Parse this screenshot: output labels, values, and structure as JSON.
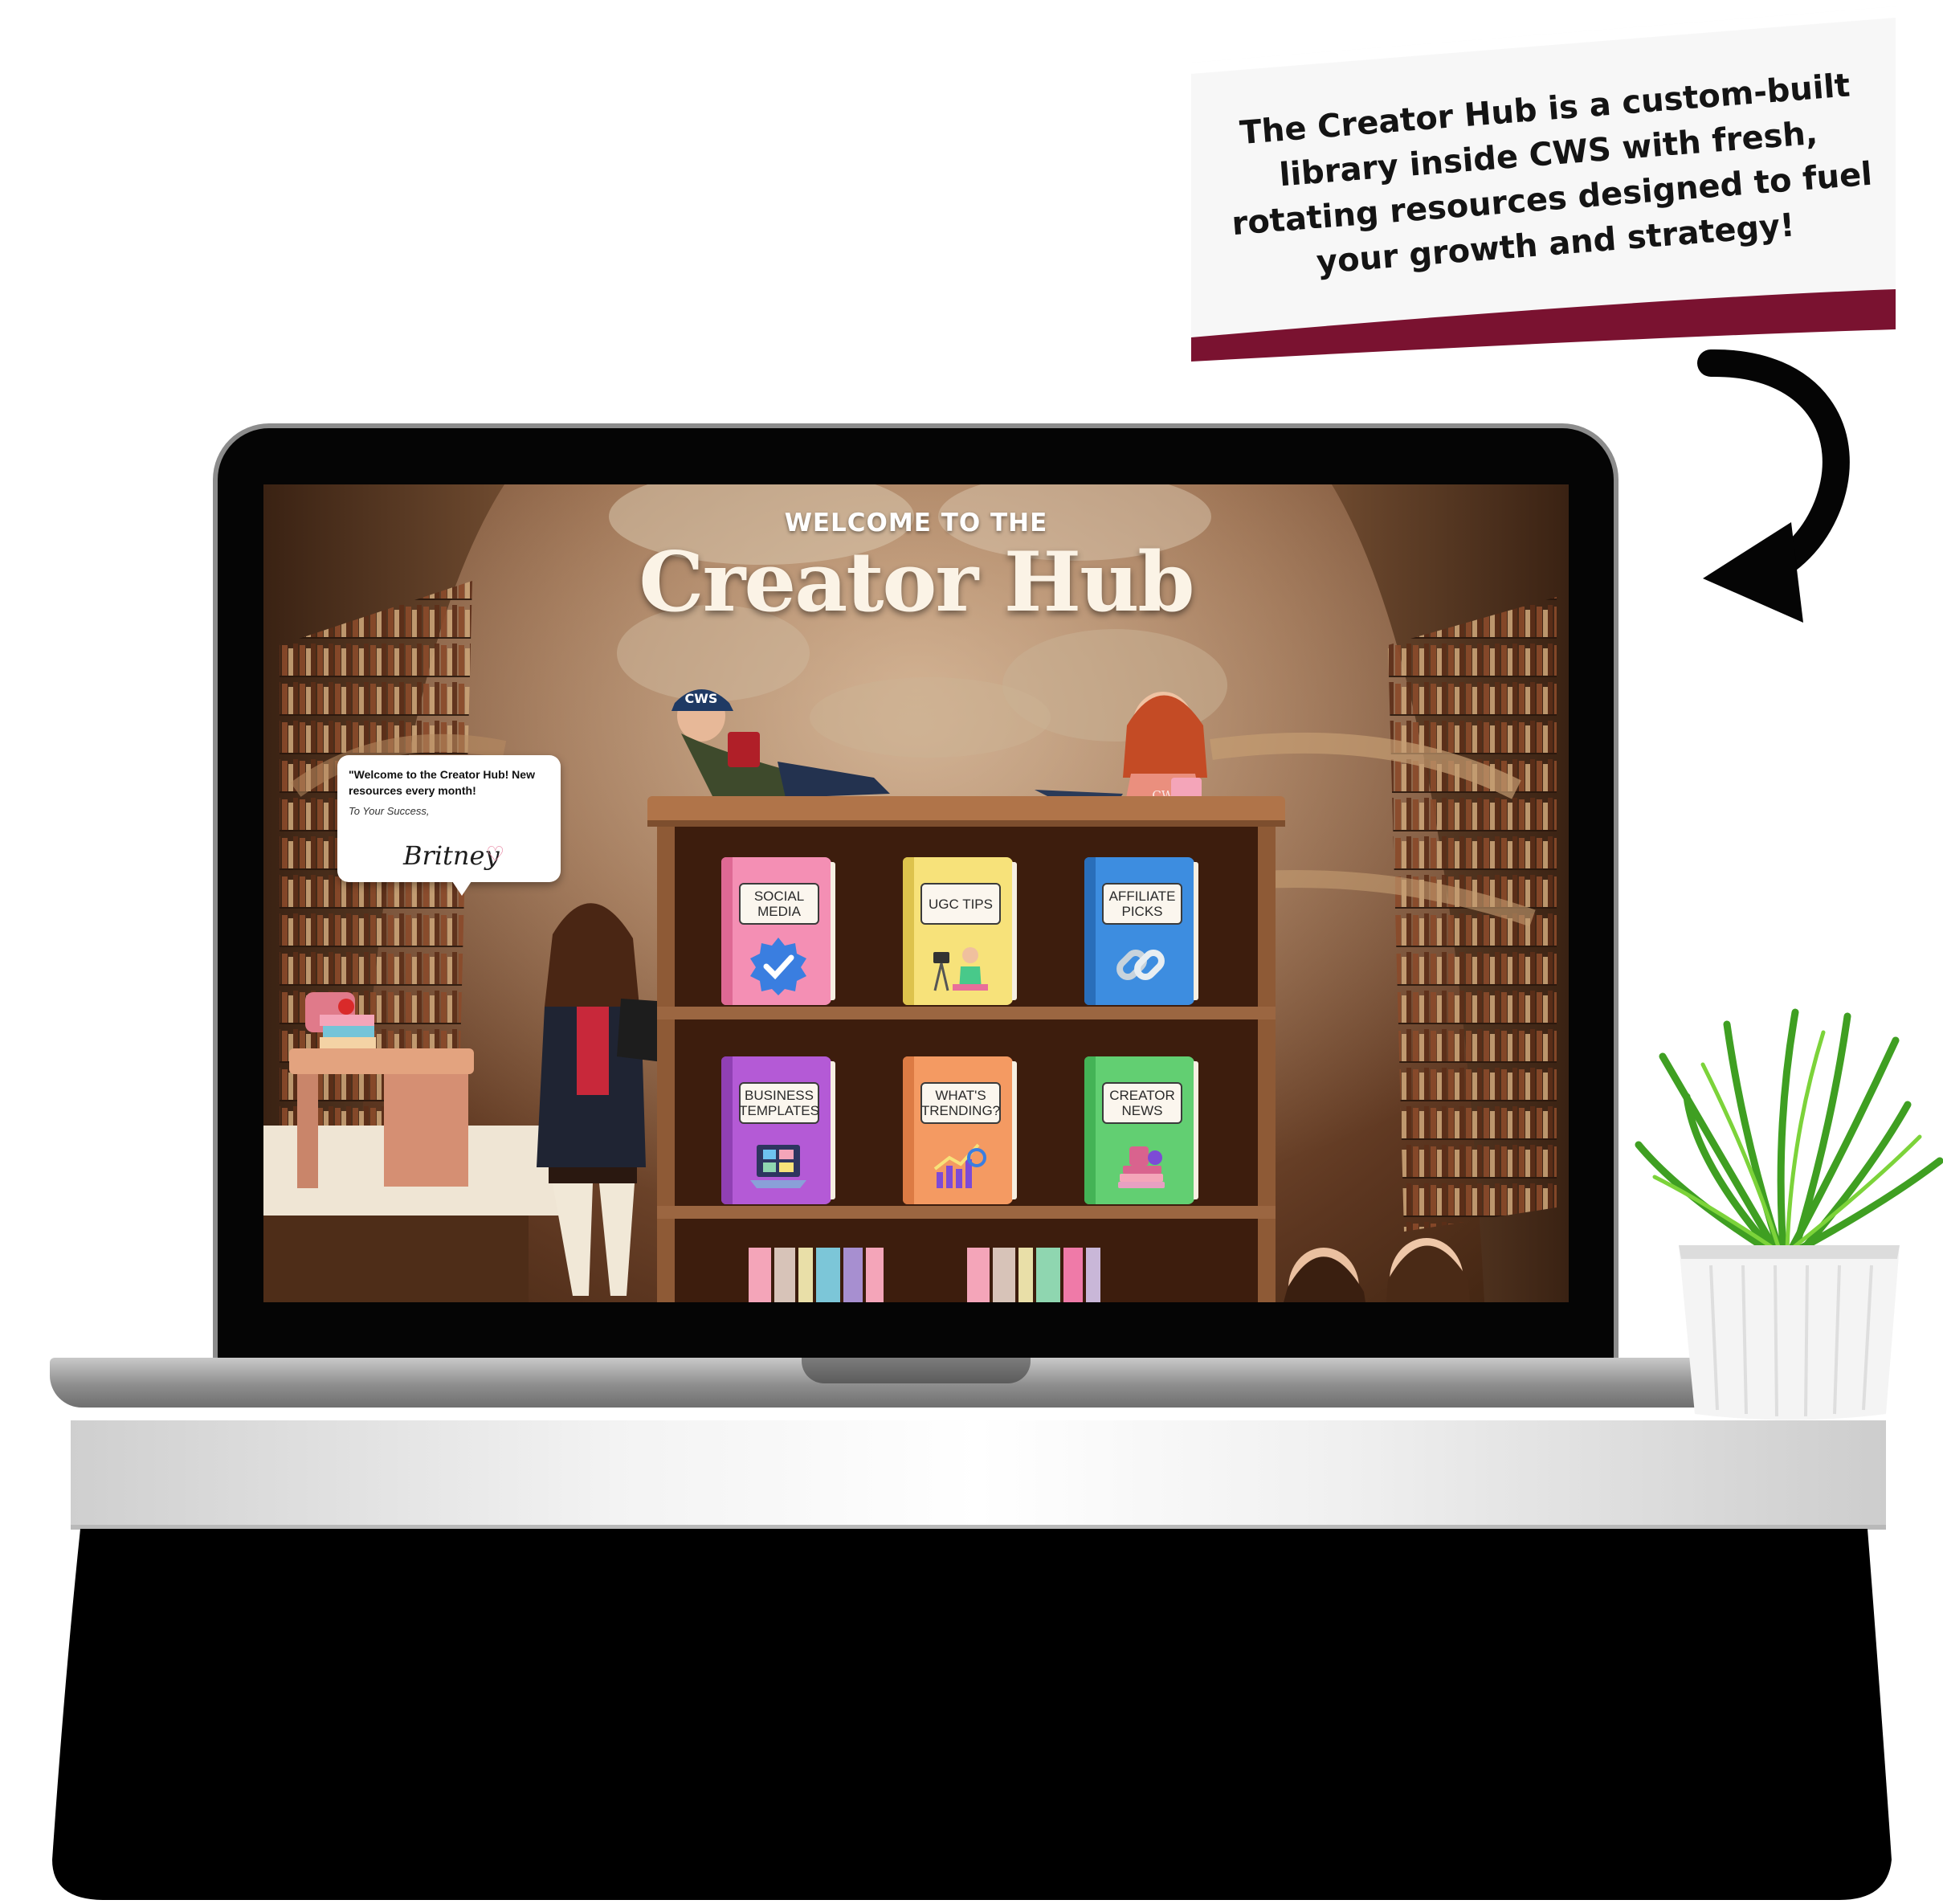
{
  "callout": {
    "text": "The Creator Hub is a custom-built library inside CWS with fresh, rotating resources designed to fuel your growth and strategy!",
    "accent_color": "#7a1230"
  },
  "screen": {
    "eyebrow": "WELCOME TO THE",
    "title": "Creator Hub",
    "bubble": {
      "message": "\"Welcome to the Creator Hub! New resources every month!",
      "closing": "To Your Success,",
      "signature": "Britney"
    },
    "characters": {
      "cap_text": "CWS",
      "shirt_text": "CWS"
    },
    "books": [
      {
        "label": "SOCIAL MEDIA",
        "color": "#f48fb4",
        "icon": "verified-badge-icon"
      },
      {
        "label": "UGC TIPS",
        "color": "#f7e27a",
        "icon": "camera-creator-icon"
      },
      {
        "label": "AFFILIATE PICKS",
        "color": "#3d8de0",
        "icon": "chain-link-icon"
      },
      {
        "label": "BUSINESS TEMPLATES",
        "color": "#b45ad6",
        "icon": "laptop-templates-icon"
      },
      {
        "label": "WHAT'S TRENDING?",
        "color": "#f49a62",
        "icon": "trend-chart-icon"
      },
      {
        "label": "CREATOR NEWS",
        "color": "#62cf72",
        "icon": "news-stack-icon"
      }
    ]
  }
}
